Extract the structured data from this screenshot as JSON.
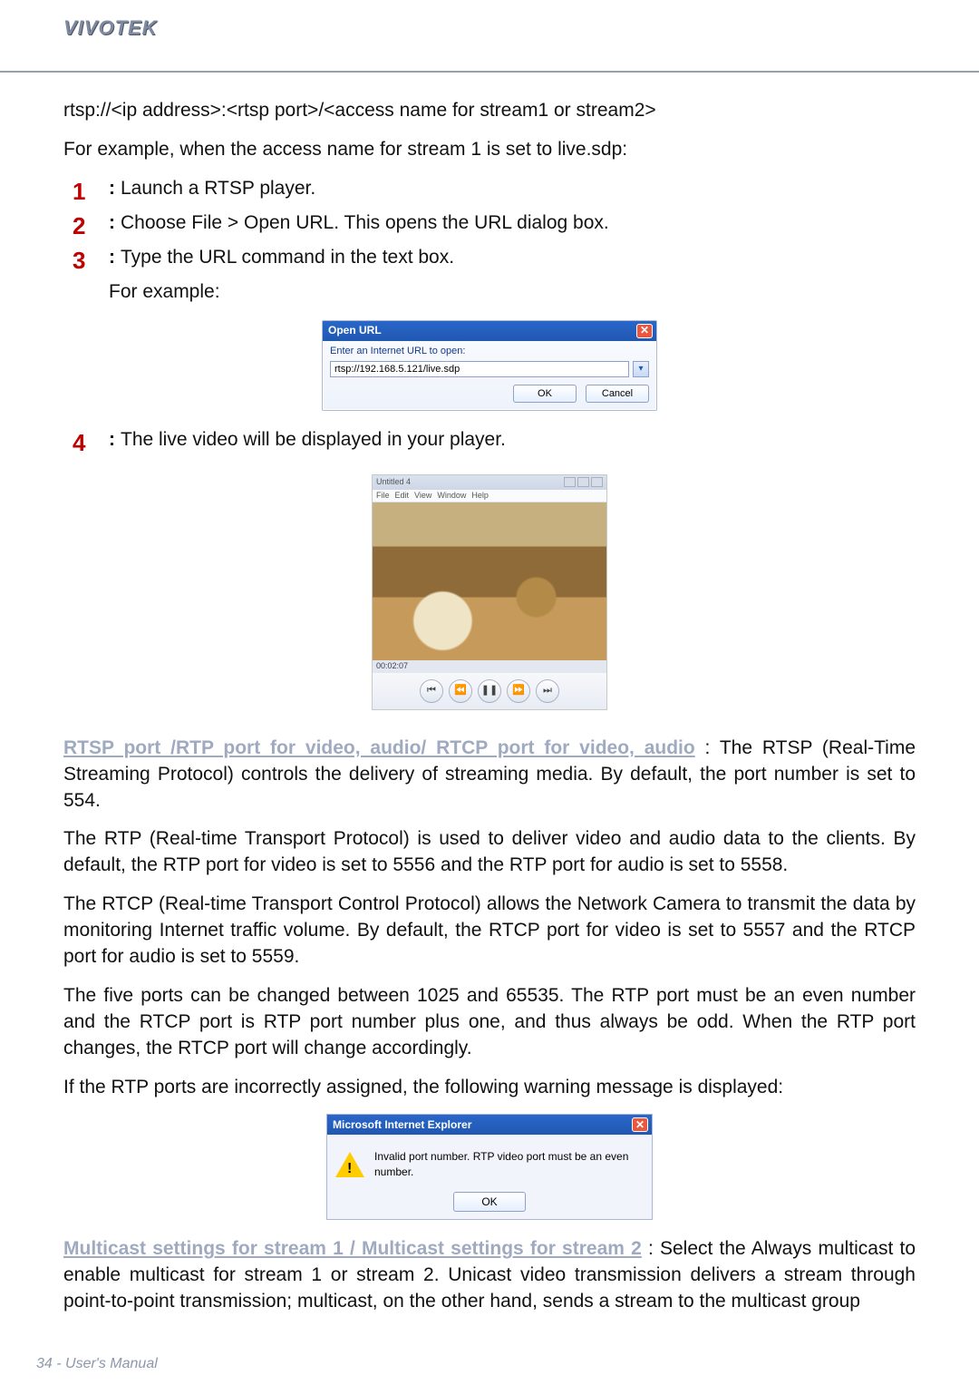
{
  "brand": "VIVOTEK",
  "rtsp_line": "rtsp://<ip address>:<rtsp port>/<access name for stream1 or stream2>",
  "intro2": "For example, when the access name for stream 1 is set to live.sdp:",
  "steps": {
    "s1": "Launch a RTSP player.",
    "s2": "Choose File > Open URL. This opens the URL dialog box.",
    "s3": "Type the URL command in the text box.",
    "s3b": "For example:",
    "s4": "The live video will be displayed in your player."
  },
  "open_url_dialog": {
    "title": "Open URL",
    "label": "Enter an Internet URL to open:",
    "value": "rtsp://192.168.5.121/live.sdp",
    "ok": "OK",
    "cancel": "Cancel"
  },
  "player": {
    "title": "Untitled 4",
    "menu": {
      "file": "File",
      "edit": "Edit",
      "view": "View",
      "window": "Window",
      "help": "Help"
    },
    "timecode": "00:02:07"
  },
  "section_rtsp_heading": "RTSP port /RTP port for video, audio/ RTCP port for video, audio",
  "rtsp_p1_after_heading": " : The RTSP (Real-Time Streaming Protocol) controls the delivery of streaming media. By default, the port number is set to 554.",
  "rtp_p": "The RTP (Real-time Transport Protocol) is used to deliver video and audio data to the clients. By default, the RTP port for video is set to 5556 and the RTP port for audio is set to 5558.",
  "rtcp_p": "The RTCP (Real-time Transport Control Protocol) allows the Network Camera to transmit the data by monitoring Internet traffic volume. By default, the RTCP port for video is set to 5557 and the RTCP port for audio is set to 5559.",
  "five_ports_p": "The five ports can be changed between 1025 and 65535. The RTP port must be an even number and the RTCP port is RTP port number plus one, and thus always be odd. When the RTP port changes, the RTCP port will change accordingly.",
  "warn_intro": "If the RTP ports are incorrectly assigned, the following warning message is displayed:",
  "warn_dialog": {
    "title": "Microsoft Internet Explorer",
    "message": "Invalid port number. RTP video port must be an even number.",
    "ok": "OK"
  },
  "section_multicast_heading": "Multicast settings for stream 1 / Multicast settings for stream 2",
  "multicast_p_after_heading": " : Select the Always multicast to enable multicast for stream 1 or stream 2. Unicast video transmission delivers a stream through point-to-point transmission; multicast, on the other hand, sends a stream to the multicast group",
  "footer": "34 - User's Manual",
  "nums": {
    "one": "1",
    "two": "2",
    "three": "3",
    "four": "4"
  },
  "sep": ":"
}
